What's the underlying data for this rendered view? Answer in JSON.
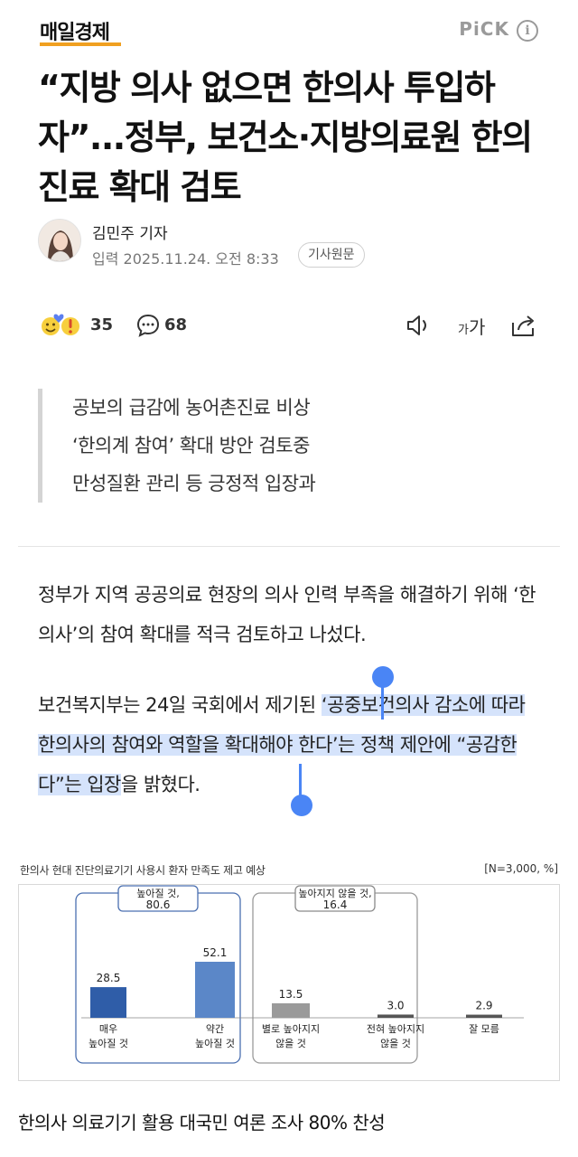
{
  "header": {
    "brand": "매일경제",
    "pick_label": "PiCK",
    "info_icon": "info-circle-icon"
  },
  "article": {
    "title": "“지방 의사 없으면 한의사 투입하자”...정부, 보건소·지방의료원 한의진료 확대 검토",
    "author": "김민주 기자",
    "published": "입력 2025.11.24. 오전 8:33",
    "original_button": "기사원문"
  },
  "toolbar": {
    "reaction_count": "35",
    "comment_count": "68",
    "font_size_label_small": "가",
    "font_size_label_large": "가"
  },
  "summary": [
    "공보의 급감에 농어촌진료 비상",
    "‘한의계 참여’ 확대 방안 검토중",
    "만성질환 관리 등 긍정적 입장과"
  ],
  "body": {
    "p1": "정부가 지역 공공의료 현장의 의사 인력 부족을 해결하기 위해 ‘한의사’의 참여 확대를 적극 검토하고 나섰다.",
    "p2_before": "보건복지부는 24일 국회에서 제기된 ",
    "p2_selected": "‘공중보건의사 감소에 따라 한의사의 참여와 역할을 확대해야 한다’는 정책 제안에 “공감한다”는 입장",
    "p2_after": "을 밝혔다."
  },
  "chart_data": {
    "type": "bar",
    "title": "한의사 현대 진단의료기기 사용시 환자 만족도 제고 예상",
    "note": "[N=3,000, %]",
    "categories": [
      "매우\n높아질 것",
      "약간\n높아질 것",
      "별로 높아지지\n않을 것",
      "전혀 높아지지\n않을 것",
      "잘 모름"
    ],
    "values": [
      28.5,
      52.1,
      13.5,
      3.0,
      2.9
    ],
    "value_labels": [
      "28.5",
      "52.1",
      "13.5",
      "3.0",
      "2.9"
    ],
    "groups": [
      {
        "label": "높아질 것,",
        "value": "80.6",
        "members": [
          0,
          1
        ]
      },
      {
        "label": "높아지지 않을 것,",
        "value": "16.4",
        "members": [
          2,
          3
        ]
      }
    ],
    "ylim": [
      0,
      60
    ],
    "colors": {
      "high": "#2f5da8",
      "mid": "#5b87c8",
      "low": "#9a9a9a",
      "none": "#555555"
    }
  },
  "caption": "한의사 의료기기 활용 대국민 여론 조사 80% 찬성"
}
